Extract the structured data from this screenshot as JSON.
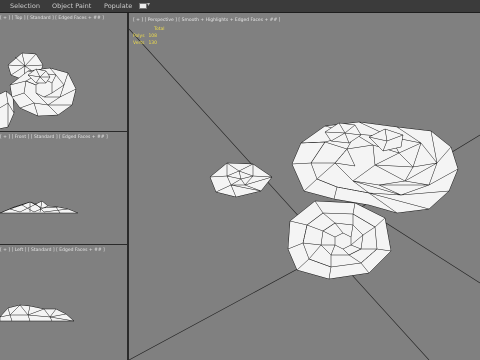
{
  "menubar": {
    "items": [
      "Selection",
      "Object Paint",
      "Populate"
    ]
  },
  "viewports": {
    "top": {
      "label": "[ + ] [ Top ] [ Standard ] [ Edged Faces + ## ]"
    },
    "front": {
      "label": "[ + ] [ Front ] [ Standard ] [ Edged Faces + ## ]"
    },
    "left": {
      "label": "[ + ] [ Left ] [ Standard ] [ Edged Faces + ## ]"
    },
    "perspective": {
      "label": "[ + ] [ Perspective ] [ Smooth + Highlights + Edged Faces + ## ]"
    }
  },
  "stats": {
    "header": "Total",
    "rows": [
      {
        "name": "Polys",
        "value": "108"
      },
      {
        "name": "Verts",
        "value": "130"
      }
    ]
  },
  "colors": {
    "viewport_bg": "#808080",
    "stats_text": "#f2df4a",
    "ui_dark": "#2a2a2a",
    "menubar": "#3b3b3b"
  }
}
